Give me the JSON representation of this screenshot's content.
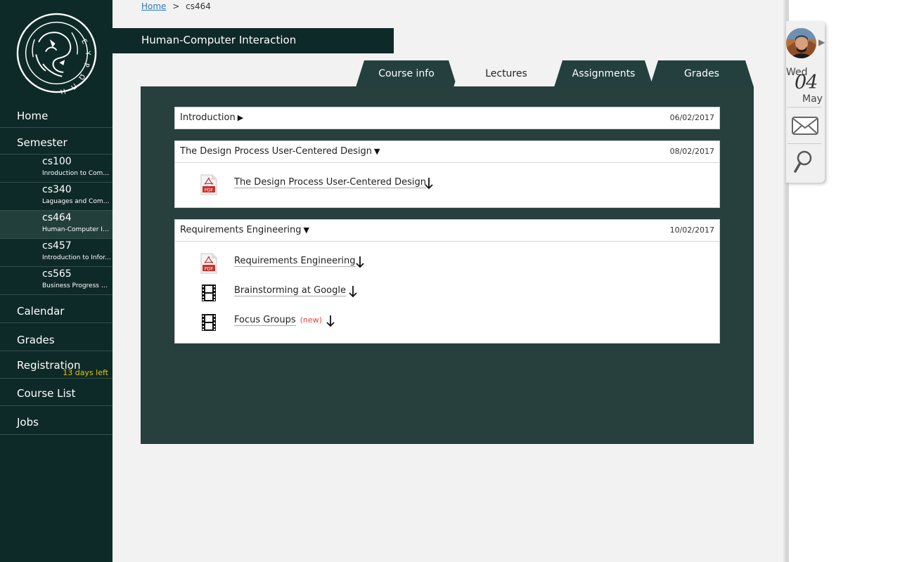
{
  "sidebar": {
    "home": "Home",
    "semester": "Semester",
    "courses": [
      {
        "code": "cs100",
        "name": "Inroduction to Comp..."
      },
      {
        "code": "cs340",
        "name": "Laguages and Compi..."
      },
      {
        "code": "cs464",
        "name": "Human-Computer In..."
      },
      {
        "code": "cs457",
        "name": "Introduction to Infor..."
      },
      {
        "code": "cs565",
        "name": "Business Progress M..."
      }
    ],
    "calendar": "Calendar",
    "grades": "Grades",
    "registration": "Registration",
    "registration_note": "13 days left",
    "course_list": "Course List",
    "jobs": "Jobs"
  },
  "breadcrumb": {
    "home": "Home",
    "separator": ">",
    "current": "cs464"
  },
  "course_title": "Human-Computer Interaction",
  "tabs": [
    {
      "label": "Course info"
    },
    {
      "label": "Lectures"
    },
    {
      "label": "Assignments"
    },
    {
      "label": "Grades"
    }
  ],
  "lectures": [
    {
      "title": "Introduction",
      "arrow": "▶",
      "date": "06/02/2017",
      "files": []
    },
    {
      "title": "The Design Process User-Centered Design",
      "arrow": "▼",
      "date": "08/02/2017",
      "files": [
        {
          "name": "The Design Process User-Centered Design",
          "icon": "pdf-icon",
          "new": ""
        }
      ]
    },
    {
      "title": "Requirements Engineering",
      "arrow": "▼",
      "date": "10/02/2017",
      "files": [
        {
          "name": "Requirements Engineering",
          "icon": "pdf-icon",
          "new": ""
        },
        {
          "name": "Brainstorming at Google",
          "icon": "video-icon",
          "new": ""
        },
        {
          "name": "Focus Groups",
          "icon": "video-icon",
          "new": "(new)"
        }
      ]
    }
  ],
  "widget": {
    "day_of_week": "Wed",
    "day": "04",
    "month": "May"
  },
  "colors": {
    "sidebar": "#0e2a28",
    "panel": "#273f3d",
    "tab": "#23403e",
    "accent_note": "#e3c40c",
    "new_badge": "#e0443b",
    "link": "#2a7ab9"
  }
}
